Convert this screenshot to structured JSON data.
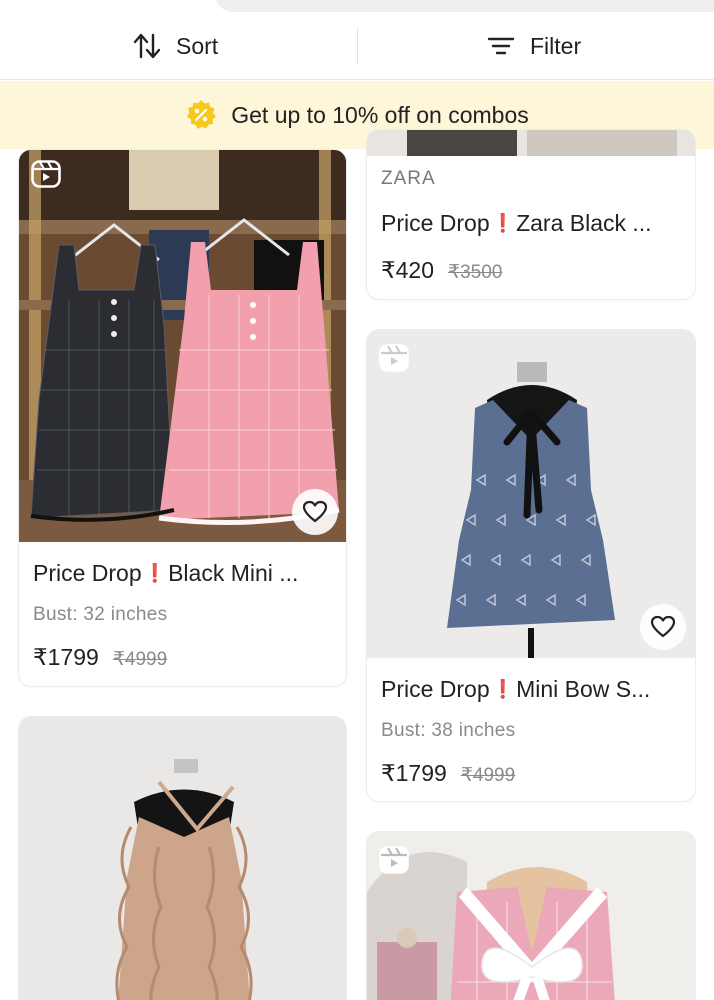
{
  "toolbar": {
    "sort_label": "Sort",
    "filter_label": "Filter"
  },
  "banner": {
    "text": "Get up to 10% off on combos",
    "badge_icon": "percent-badge-icon",
    "badge_color": "#f5c81a"
  },
  "products": [
    {
      "title_prefix": "Price Drop",
      "title_rest": "Black Mini ...",
      "detail": "Bust: 32 inches",
      "price": "₹1799",
      "mrp": "₹4999"
    },
    {
      "brand": "ZARA",
      "title_prefix": "Price Drop",
      "title_rest": "Zara Black ...",
      "price": "₹420",
      "mrp": "₹3500"
    },
    {
      "title_prefix": "Price Drop",
      "title_rest": "Mini Bow S...",
      "detail": "Bust: 38 inches",
      "price": "₹1799",
      "mrp": "₹4999"
    }
  ],
  "accent": {
    "exclamation": "#d5283a",
    "banner_bg": "#fdf6d9"
  }
}
